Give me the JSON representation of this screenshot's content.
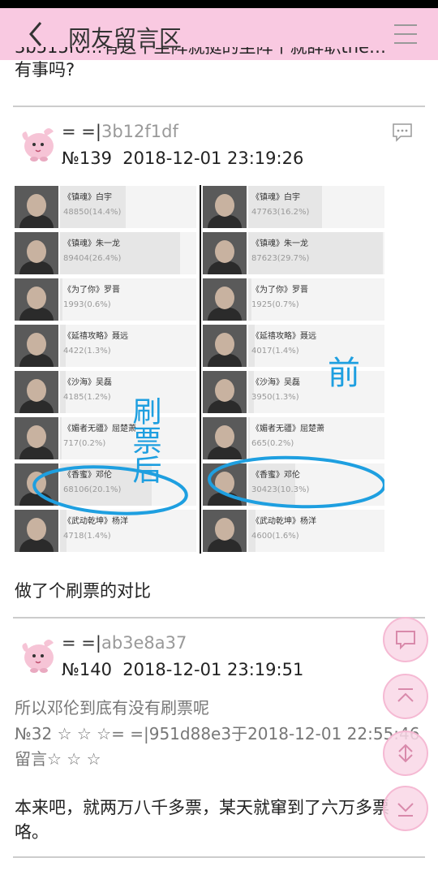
{
  "header": {
    "title": "网友留言区"
  },
  "previous_post": {
    "cut_line": "3b515f0…有这个坐阵就挺的坐阵个就辞职the…",
    "tail": "有事吗?"
  },
  "posts": [
    {
      "author_prefix": "= =|",
      "author_id": "3b12f1df",
      "number": "№139",
      "datetime": "2018-12-01 23:19:26",
      "figure": {
        "annotation_left": "刷票后",
        "annotation_right": "前",
        "after": [
          {
            "name": "《镇魂》白宇",
            "count": "48850(14.4%)",
            "pct": 14.4
          },
          {
            "name": "《镇魂》朱一龙",
            "count": "89404(26.4%)",
            "pct": 26.4
          },
          {
            "name": "《为了你》罗晋",
            "count": "1993(0.6%)",
            "pct": 0.6
          },
          {
            "name": "《延禧攻略》聂远",
            "count": "4422(1.3%)",
            "pct": 1.3
          },
          {
            "name": "《沙海》吴磊",
            "count": "4185(1.2%)",
            "pct": 1.2
          },
          {
            "name": "《媚者无疆》屈楚萧",
            "count": "717(0.2%)",
            "pct": 0.2
          },
          {
            "name": "《香蜜》邓伦",
            "count": "68106(20.1%)",
            "pct": 20.1
          },
          {
            "name": "《武动乾坤》杨洋",
            "count": "4718(1.4%)",
            "pct": 1.4
          }
        ],
        "before": [
          {
            "name": "《镇魂》白宇",
            "count": "47763(16.2%)",
            "pct": 16.2
          },
          {
            "name": "《镇魂》朱一龙",
            "count": "87623(29.7%)",
            "pct": 29.7
          },
          {
            "name": "《为了你》罗晋",
            "count": "1925(0.7%)",
            "pct": 0.7
          },
          {
            "name": "《延禧攻略》聂远",
            "count": "4017(1.4%)",
            "pct": 1.4
          },
          {
            "name": "《沙海》吴磊",
            "count": "3950(1.3%)",
            "pct": 1.3
          },
          {
            "name": "《媚者无疆》屈楚萧",
            "count": "665(0.2%)",
            "pct": 0.2
          },
          {
            "name": "《香蜜》邓伦",
            "count": "30423(10.3%)",
            "pct": 10.3
          },
          {
            "name": "《武动乾坤》杨洋",
            "count": "4600(1.6%)",
            "pct": 1.6
          }
        ]
      },
      "text": "做了个刷票的对比"
    },
    {
      "author_prefix": "= =|",
      "author_id": "ab3e8a37",
      "number": "№140",
      "datetime": "2018-12-01 23:19:51",
      "quote_line1": "所以邓伦到底有没有刷票呢",
      "quote_line2": "№32 ☆ ☆ ☆= =|951d88e3于2018-12-01 22:55:46",
      "quote_line3": "留言☆ ☆ ☆",
      "text": "本来吧，就两万八千多票，某天就窜到了六万多票咯。"
    }
  ],
  "colors": {
    "header_bg": "#f9c9e1",
    "fab_bg": "#f9d7e6",
    "annotation": "#1e9fe0"
  },
  "fab_icons": [
    "comment-icon",
    "scroll-top-icon",
    "refresh-icon",
    "scroll-bottom-icon"
  ]
}
